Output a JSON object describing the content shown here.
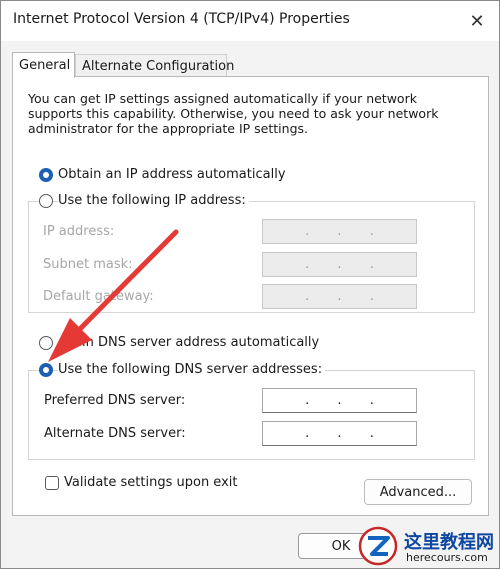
{
  "window": {
    "title": "Internet Protocol Version 4 (TCP/IPv4) Properties",
    "close_icon": "close-icon"
  },
  "tabs": [
    {
      "label": "General",
      "selected": true
    },
    {
      "label": "Alternate Configuration",
      "selected": false
    }
  ],
  "description": "You can get IP settings assigned automatically if your network supports this capability. Otherwise, you need to ask your network administrator for the appropriate IP settings.",
  "ip_section": {
    "auto_label": "Obtain an IP address automatically",
    "auto_selected": true,
    "manual_label": "Use the following IP address:",
    "manual_selected": false,
    "fields": [
      {
        "label": "IP address:",
        "value": ". . ."
      },
      {
        "label": "Subnet mask:",
        "value": ". . ."
      },
      {
        "label": "Default gateway:",
        "value": ". . ."
      }
    ]
  },
  "dns_section": {
    "auto_label": "in DNS server address automatically",
    "auto_selected": false,
    "manual_label": "Use the following DNS server addresses:",
    "manual_selected": true,
    "fields": [
      {
        "label": "Preferred DNS server:",
        "value": ". . ."
      },
      {
        "label": "Alternate DNS server:",
        "value": ". . ."
      }
    ]
  },
  "validate_label": "Validate settings upon exit",
  "validate_checked": false,
  "buttons": {
    "advanced": "Advanced...",
    "ok": "OK"
  },
  "annotation": {
    "arrow_color": "#e53935"
  },
  "watermark": {
    "title": "这里教程网",
    "url": "herecours.com"
  },
  "colors": {
    "accent": "#1e5fb4",
    "panel": "#ffffff",
    "window": "#f3f3f3"
  }
}
